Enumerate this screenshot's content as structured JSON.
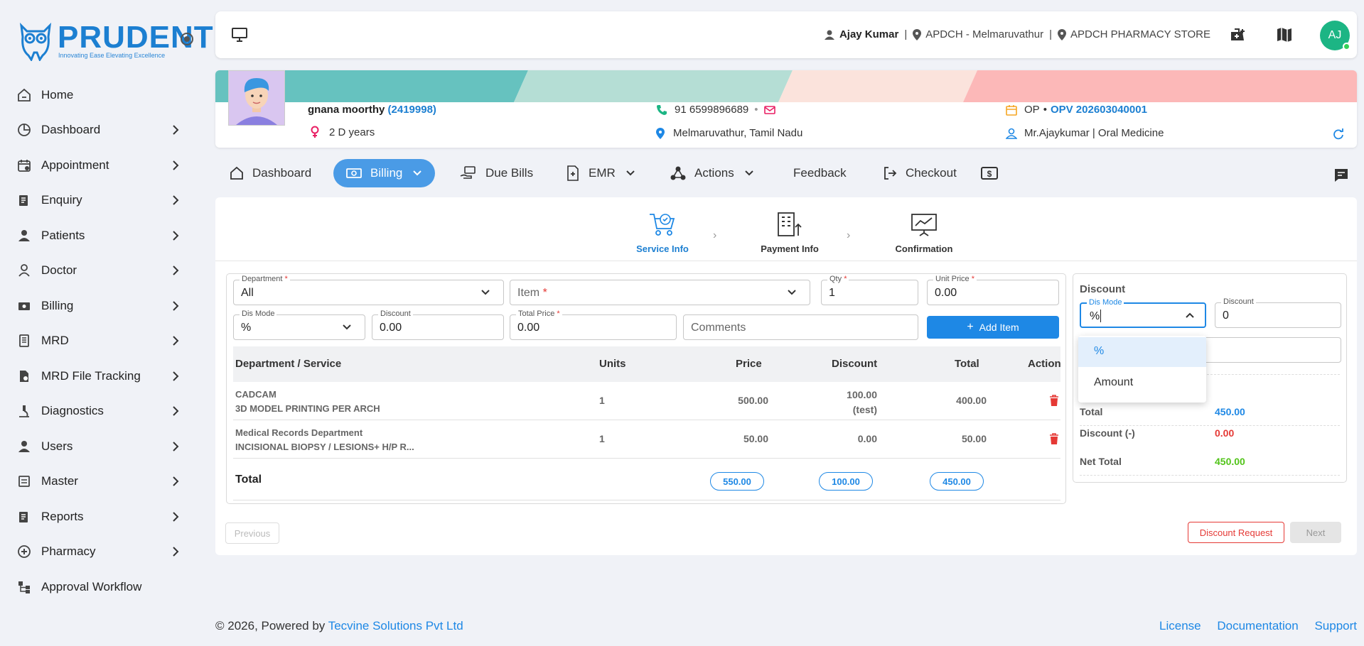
{
  "brand": {
    "name": "PRUDENT",
    "tagline": "Innovating Ease Elevating Excellence"
  },
  "sidebar": {
    "items": [
      {
        "label": "Home",
        "icon": "home-icon",
        "has_sub": false
      },
      {
        "label": "Dashboard",
        "icon": "pie-chart-icon",
        "has_sub": true
      },
      {
        "label": "Appointment",
        "icon": "calendar-clock-icon",
        "has_sub": true
      },
      {
        "label": "Enquiry",
        "icon": "document-icon",
        "has_sub": true
      },
      {
        "label": "Patients",
        "icon": "person-icon",
        "has_sub": true
      },
      {
        "label": "Doctor",
        "icon": "doctor-icon",
        "has_sub": true
      },
      {
        "label": "Billing",
        "icon": "money-icon",
        "has_sub": true
      },
      {
        "label": "MRD",
        "icon": "records-icon",
        "has_sub": true
      },
      {
        "label": "MRD File Tracking",
        "icon": "file-search-icon",
        "has_sub": true
      },
      {
        "label": "Diagnostics",
        "icon": "microscope-icon",
        "has_sub": true
      },
      {
        "label": "Users",
        "icon": "user-icon",
        "has_sub": true
      },
      {
        "label": "Master",
        "icon": "list-box-icon",
        "has_sub": true
      },
      {
        "label": "Reports",
        "icon": "report-icon",
        "has_sub": true
      },
      {
        "label": "Pharmacy",
        "icon": "pharmacy-icon",
        "has_sub": true
      },
      {
        "label": "Approval Workflow",
        "icon": "workflow-icon",
        "has_sub": false
      }
    ]
  },
  "topbar": {
    "user": "Ajay Kumar",
    "location": "APDCH - Melmaruvathur",
    "store": "APDCH PHARMACY STORE",
    "avatar_initials": "AJ"
  },
  "patient": {
    "name": "gnana moorthy",
    "id": "(2419998)",
    "age": "2 D years",
    "phone": "91 6599896689",
    "place": "Melmaruvathur, Tamil Nadu",
    "visit_type": "OP",
    "visit_sep": "•",
    "visit_no": "OPV 202603040001",
    "doctor": "Mr.Ajaykumar | Oral Medicine"
  },
  "tabs": [
    {
      "label": "Dashboard"
    },
    {
      "label": "Billing"
    },
    {
      "label": "Due Bills"
    },
    {
      "label": "EMR"
    },
    {
      "label": "Actions"
    },
    {
      "label": "Feedback"
    },
    {
      "label": "Checkout"
    }
  ],
  "steps": [
    {
      "label": "Service Info"
    },
    {
      "label": "Payment Info"
    },
    {
      "label": "Confirmation"
    }
  ],
  "form": {
    "department": {
      "label": "Department",
      "value": "All"
    },
    "item": {
      "placeholder": "Item"
    },
    "qty": {
      "label": "Qty",
      "value": "1"
    },
    "unit_price": {
      "label": "Unit Price",
      "value": "0.00"
    },
    "dis_mode": {
      "label": "Dis Mode",
      "value": "%"
    },
    "discount": {
      "label": "Discount",
      "value": "0.00"
    },
    "total_price": {
      "label": "Total Price",
      "value": "0.00"
    },
    "comments": {
      "placeholder": "Comments"
    },
    "add_button": "Add Item"
  },
  "table": {
    "headers": [
      "Department / Service",
      "Units",
      "Price",
      "Discount",
      "Total",
      "Action"
    ],
    "rows": [
      {
        "dept": "CADCAM",
        "service": "3D MODEL PRINTING PER ARCH",
        "units": "1",
        "price": "500.00",
        "discount": "100.00",
        "discount_note": "(test)",
        "total": "400.00"
      },
      {
        "dept": "Medical Records Department",
        "service": "INCISIONAL BIOPSY / LESIONS+ H/P R...",
        "units": "1",
        "price": "50.00",
        "discount": "0.00",
        "discount_note": "",
        "total": "50.00"
      }
    ],
    "total_label": "Total",
    "total_price": "550.00",
    "total_discount": "100.00",
    "total_total": "450.00"
  },
  "discount_panel": {
    "title": "Discount",
    "dis_mode_label": "Dis Mode",
    "dis_mode_value": "%",
    "discount_label": "Discount",
    "discount_value": "0",
    "total_label": "Total",
    "total_value": "450.00",
    "discount_minus_label": "Discount (-)",
    "discount_minus_value": "0.00",
    "net_label": "Net Total",
    "net_value": "450.00",
    "options": [
      "%",
      "Amount"
    ]
  },
  "buttons": {
    "previous": "Previous",
    "discount_request": "Discount Request",
    "next": "Next"
  },
  "footer": {
    "copyright": "© 2026, Powered by",
    "company": "Tecvine Solutions Pvt Ltd",
    "links": [
      "License",
      "Documentation",
      "Support"
    ]
  },
  "colors": {
    "accent": "#1e88e5",
    "danger": "#e53935",
    "success": "#52c41a",
    "avatar": "#1cb584"
  }
}
